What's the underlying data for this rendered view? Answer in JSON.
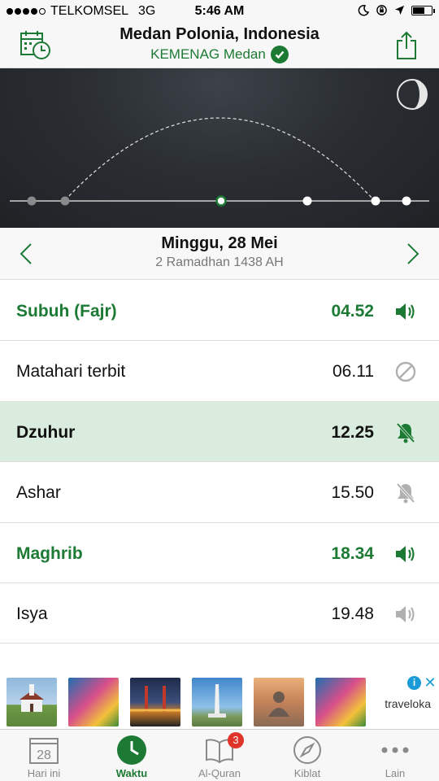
{
  "status_bar": {
    "carrier": "TELKOMSEL",
    "network": "3G",
    "time": "5:46 AM"
  },
  "header": {
    "title": "Medan Polonia, Indonesia",
    "subtitle": "KEMENAG Medan",
    "left_icon": "calendar-clock-icon",
    "right_icon": "share-icon"
  },
  "sky": {
    "moon_icon": "moon-phase-icon",
    "sun_position_marker": "current-prayer-marker"
  },
  "date": {
    "gregorian": "Minggu, 28 Mei",
    "hijri": "2 Ramadhan 1438 AH"
  },
  "prayers": [
    {
      "name": "Subuh (Fajr)",
      "time": "04.52",
      "alert": "speaker-icon",
      "style": "green-bold"
    },
    {
      "name": "Matahari terbit",
      "time": "06.11",
      "alert": "disabled-icon",
      "style": "normal"
    },
    {
      "name": "Dzuhur",
      "time": "12.25",
      "alert": "bell-off-icon",
      "style": "current-bold"
    },
    {
      "name": "Ashar",
      "time": "15.50",
      "alert": "bell-off-icon",
      "style": "normal"
    },
    {
      "name": "Maghrib",
      "time": "18.34",
      "alert": "speaker-icon",
      "style": "green-bold"
    },
    {
      "name": "Isya",
      "time": "19.48",
      "alert": "speaker-icon",
      "style": "normal"
    }
  ],
  "ad": {
    "logo": "traveloka"
  },
  "tabs": [
    {
      "label": "Hari ini",
      "icon": "calendar-day-icon",
      "icon_text": "28",
      "active": false
    },
    {
      "label": "Waktu",
      "icon": "clock-icon",
      "active": true
    },
    {
      "label": "Al-Quran",
      "icon": "book-icon",
      "badge": "3",
      "active": false
    },
    {
      "label": "Kiblat",
      "icon": "compass-icon",
      "active": false
    },
    {
      "label": "Lain",
      "icon": "more-icon",
      "active": false
    }
  ],
  "colors": {
    "accent_green": "#1d7a35",
    "current_row_bg": "#d9ecdd",
    "badge_red": "#e0342b"
  }
}
